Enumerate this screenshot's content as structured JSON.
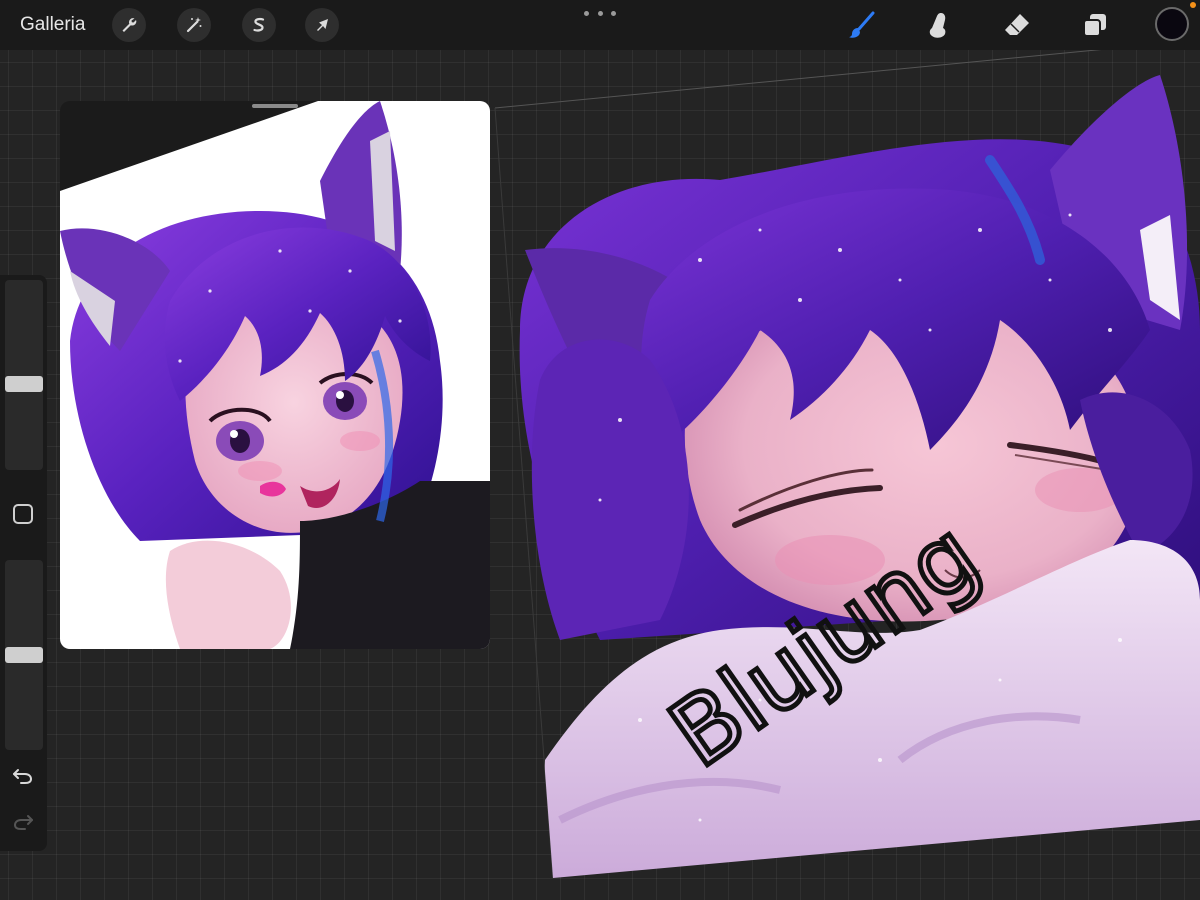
{
  "topbar": {
    "gallery_label": "Galleria",
    "actions": [
      {
        "name": "actions-button",
        "icon": "wrench-icon"
      },
      {
        "name": "adjustments-button",
        "icon": "magic-wand-icon"
      },
      {
        "name": "selection-button",
        "icon": "selection-s-icon"
      },
      {
        "name": "transform-button",
        "icon": "arrow-cursor-icon"
      }
    ],
    "more_icon": "more-dots-icon",
    "tools": [
      {
        "name": "brush-tool-button",
        "icon": "brush-icon",
        "active": true
      },
      {
        "name": "smudge-tool-button",
        "icon": "smudge-finger-icon",
        "active": false
      },
      {
        "name": "eraser-tool-button",
        "icon": "eraser-icon",
        "active": false
      },
      {
        "name": "layers-button",
        "icon": "layers-icon",
        "active": false
      }
    ],
    "current_color": "#0a0710"
  },
  "colors": {
    "accent": "#2d7bf5",
    "notification": "#f39019"
  },
  "sidebar": {
    "brush_size": 0.45,
    "brush_opacity": 0.5,
    "modify_icon": "square-outline-icon",
    "undo_icon": "undo-arrow-icon",
    "redo_icon": "redo-arrow-icon",
    "redo_enabled": false
  },
  "canvas": {
    "signature": "Blujung"
  }
}
